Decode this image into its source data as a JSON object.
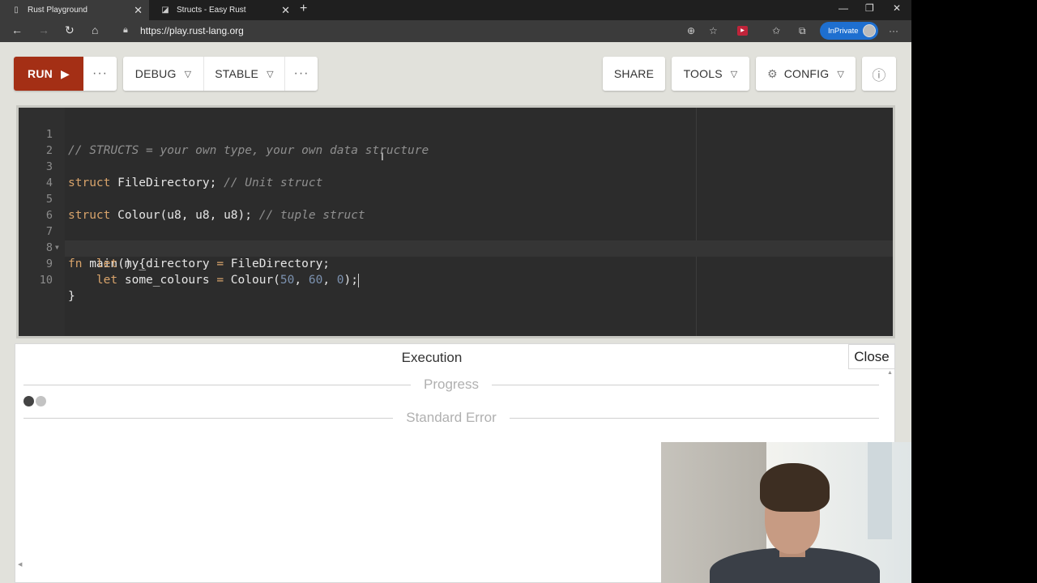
{
  "browser": {
    "tabs": [
      {
        "title": "Rust Playground",
        "active": true
      },
      {
        "title": "Structs - Easy Rust",
        "active": false
      }
    ],
    "url": "https://play.rust-lang.org",
    "inprivate_label": "InPrivate"
  },
  "toolbar": {
    "run_label": "RUN",
    "debug_label": "DEBUG",
    "stable_label": "STABLE",
    "share_label": "SHARE",
    "tools_label": "TOOLS",
    "config_label": "CONFIG",
    "more_label": "···"
  },
  "editor": {
    "line_numbers": [
      "1",
      "2",
      "3",
      "4",
      "5",
      "6",
      "7",
      "8",
      "9",
      "10"
    ],
    "line1": {
      "comment": "// STRUCTS = your own type, your own data structure"
    },
    "line3": {
      "kw": "struct",
      "rest": " FileDirectory; ",
      "comment": "// Unit struct"
    },
    "line5": {
      "kw": "struct",
      "rest": " Colour(u8, u8, u8); ",
      "comment": "// tuple struct"
    },
    "line7": {
      "kw": "fn",
      "rest": " main() {"
    },
    "line8": {
      "indent": "    ",
      "kw": "let",
      "name": " my_directory ",
      "op": "=",
      "rest": " FileDirectory;"
    },
    "line9": {
      "indent": "    ",
      "kw": "let",
      "name": " some_colours ",
      "op": "=",
      "pre": " Colour(",
      "n1": "50",
      "c1": ", ",
      "n2": "60",
      "c2": ", ",
      "n3": "0",
      "post": ");"
    },
    "line10": {
      "code": "}"
    }
  },
  "output": {
    "title": "Execution",
    "close_label": "Close",
    "progress_label": "Progress",
    "stderr_label": "Standard Error"
  },
  "colors": {
    "run_button": "#a42f15",
    "editor_bg": "#2c2c2c",
    "keyword": "#d9a46b",
    "comment": "#8f8f8f",
    "number": "#7c92b0",
    "inprivate": "#1e6fd0"
  }
}
